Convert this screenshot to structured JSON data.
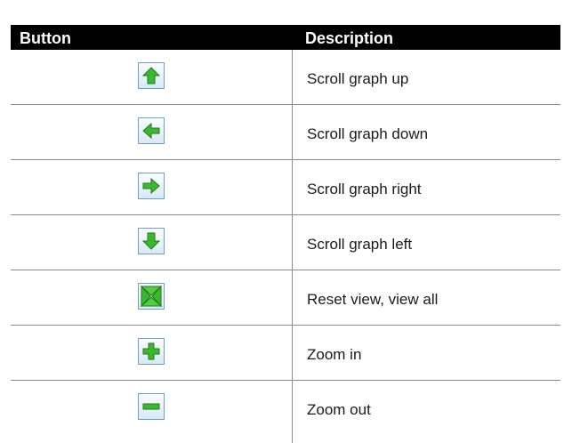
{
  "table": {
    "headers": {
      "button": "Button",
      "description": "Description"
    },
    "rows": [
      {
        "icon": "arrow-up-icon",
        "description": "Scroll graph up"
      },
      {
        "icon": "arrow-left-icon",
        "description": "Scroll graph down"
      },
      {
        "icon": "arrow-right-icon",
        "description": "Scroll graph right"
      },
      {
        "icon": "arrow-down-icon",
        "description": "Scroll graph left"
      },
      {
        "icon": "reset-view-icon",
        "description": "Reset view, view all"
      },
      {
        "icon": "plus-icon",
        "description": "Zoom in"
      },
      {
        "icon": "minus-icon",
        "description": "Zoom out"
      }
    ]
  },
  "colors": {
    "icon_green": "#3cb82e",
    "icon_border": "#6f9fc8",
    "header_bg": "#000000"
  }
}
